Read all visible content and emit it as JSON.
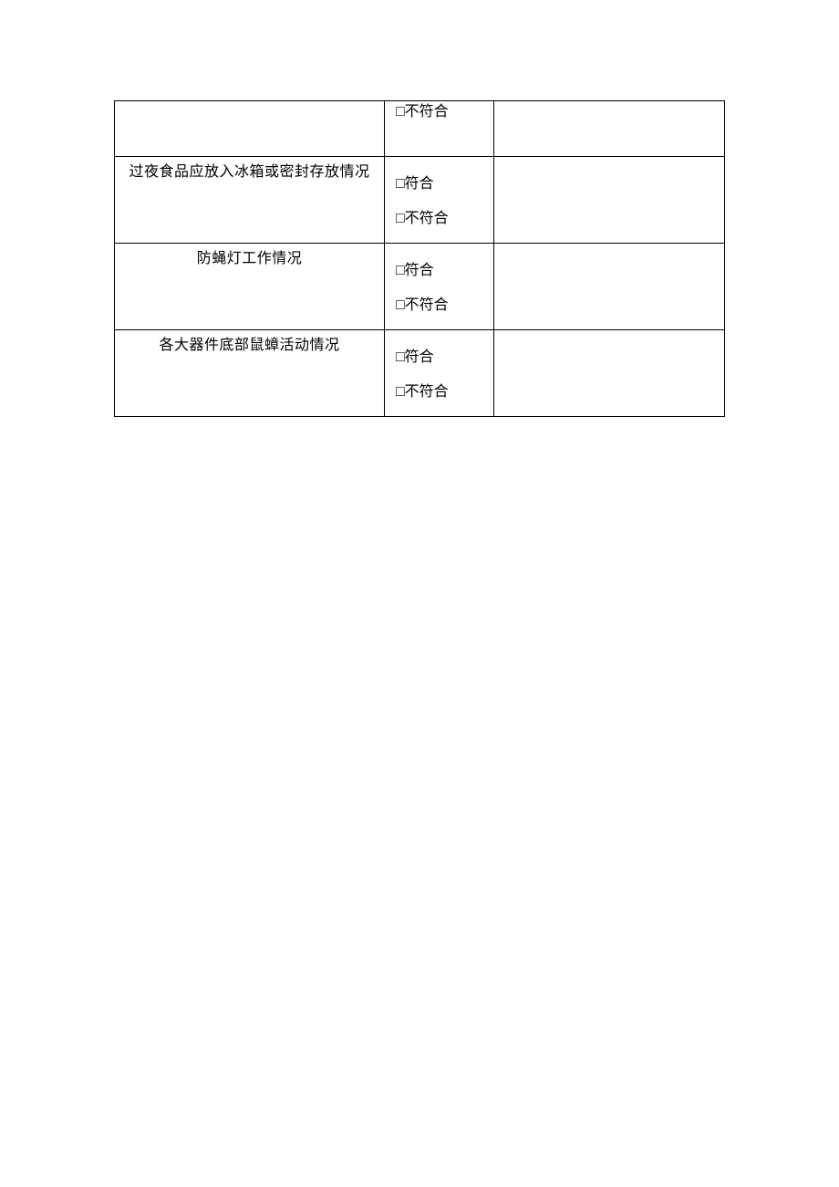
{
  "labels": {
    "conform": "□符合",
    "nonconform": "□不符合"
  },
  "rows": [
    {
      "item": "",
      "mode": "partial"
    },
    {
      "item": "过夜食品应放入冰箱或密封存放情况",
      "mode": "full"
    },
    {
      "item": "防蝇灯工作情况",
      "mode": "full"
    },
    {
      "item": "各大器件底部鼠蟑活动情况",
      "mode": "full"
    }
  ]
}
